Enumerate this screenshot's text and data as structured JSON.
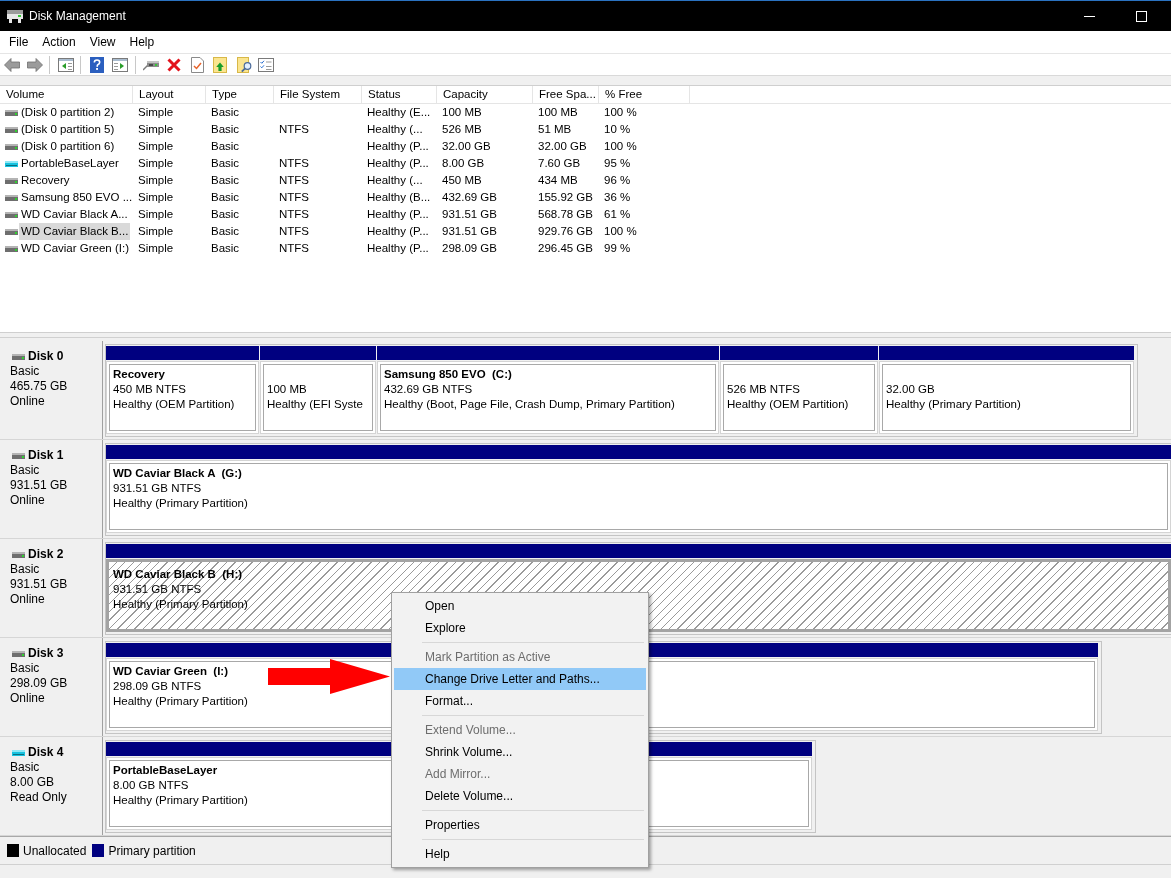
{
  "window": {
    "title": "Disk Management"
  },
  "menu_bar": [
    "File",
    "Action",
    "View",
    "Help"
  ],
  "volume_table": {
    "columns": [
      "Volume",
      "Layout",
      "Type",
      "File System",
      "Status",
      "Capacity",
      "Free Spa...",
      "% Free"
    ],
    "rows": [
      {
        "kind": "fixed",
        "selected": false,
        "cells": [
          "(Disk 0 partition 2)",
          "Simple",
          "Basic",
          null,
          "Healthy (E...",
          "100 MB",
          "100 MB",
          "100 %"
        ]
      },
      {
        "kind": "fixed",
        "selected": false,
        "cells": [
          "(Disk 0 partition 5)",
          "Simple",
          "Basic",
          "NTFS",
          "Healthy (...",
          "526 MB",
          "51 MB",
          "10 %"
        ]
      },
      {
        "kind": "fixed",
        "selected": false,
        "cells": [
          "(Disk 0 partition 6)",
          "Simple",
          "Basic",
          null,
          "Healthy (P...",
          "32.00 GB",
          "32.00 GB",
          "100 %"
        ]
      },
      {
        "kind": "removable",
        "selected": false,
        "cells": [
          "PortableBaseLayer",
          "Simple",
          "Basic",
          "NTFS",
          "Healthy (P...",
          "8.00 GB",
          "7.60 GB",
          "95 %"
        ]
      },
      {
        "kind": "fixed",
        "selected": false,
        "cells": [
          "Recovery",
          "Simple",
          "Basic",
          "NTFS",
          "Healthy (...",
          "450 MB",
          "434 MB",
          "96 %"
        ]
      },
      {
        "kind": "fixed",
        "selected": false,
        "cells": [
          "Samsung 850 EVO ...",
          "Simple",
          "Basic",
          "NTFS",
          "Healthy (B...",
          "432.69 GB",
          "155.92 GB",
          "36 %"
        ]
      },
      {
        "kind": "fixed",
        "selected": false,
        "cells": [
          "WD Caviar Black A...",
          "Simple",
          "Basic",
          "NTFS",
          "Healthy (P...",
          "931.51 GB",
          "568.78 GB",
          "61 %"
        ]
      },
      {
        "kind": "fixed",
        "selected": true,
        "cells": [
          "WD Caviar Black B...",
          "Simple",
          "Basic",
          "NTFS",
          "Healthy (P...",
          "931.51 GB",
          "929.76 GB",
          "100 %"
        ]
      },
      {
        "kind": "fixed",
        "selected": false,
        "cells": [
          "WD Caviar Green (I:)",
          "Simple",
          "Basic",
          "NTFS",
          "Healthy (P...",
          "298.09 GB",
          "296.45 GB",
          "99 %"
        ]
      }
    ]
  },
  "disks": [
    {
      "kind": "fixed",
      "name": "Disk 0",
      "type": "Basic",
      "size": "465.75 GB",
      "status": "Online",
      "partitions": [
        {
          "name": "Recovery",
          "size": "450 MB NTFS",
          "status": "Healthy (OEM Partition)",
          "selected": false
        },
        {
          "size": "100 MB",
          "status": "Healthy (EFI Syste",
          "selected": false
        },
        {
          "name": "Samsung 850 EVO  (C:)",
          "size": "432.69 GB NTFS",
          "status": "Healthy (Boot, Page File, Crash Dump, Primary Partition)",
          "selected": false
        },
        {
          "size": "526 MB NTFS",
          "status": "Healthy (OEM Partition)",
          "selected": false
        },
        {
          "size": "32.00 GB",
          "status": "Healthy (Primary Partition)",
          "selected": false
        }
      ]
    },
    {
      "kind": "fixed",
      "name": "Disk 1",
      "type": "Basic",
      "size": "931.51 GB",
      "status": "Online",
      "partitions": [
        {
          "name": "WD Caviar Black A  (G:)",
          "size": "931.51 GB NTFS",
          "status": "Healthy (Primary Partition)",
          "selected": false
        }
      ]
    },
    {
      "kind": "fixed",
      "name": "Disk 2",
      "type": "Basic",
      "size": "931.51 GB",
      "status": "Online",
      "partitions": [
        {
          "name": "WD Caviar Black B  (H:)",
          "size": "931.51 GB NTFS",
          "status": "Healthy (Primary Partition)",
          "selected": true
        }
      ]
    },
    {
      "kind": "fixed",
      "name": "Disk 3",
      "type": "Basic",
      "size": "298.09 GB",
      "status": "Online",
      "partitions": [
        {
          "name": "WD Caviar Green  (I:)",
          "size": "298.09 GB NTFS",
          "status": "Healthy (Primary Partition)",
          "selected": false
        }
      ]
    },
    {
      "kind": "removable",
      "name": "Disk 4",
      "type": "Basic",
      "size": "8.00 GB",
      "status": "Read Only",
      "partitions": [
        {
          "name": "PortableBaseLayer",
          "size": "8.00 GB NTFS",
          "status": "Healthy (Primary Partition)",
          "selected": false
        }
      ]
    }
  ],
  "legend": [
    {
      "label": "Unallocated",
      "color": "#000000"
    },
    {
      "label": "Primary partition",
      "color": "#000080"
    }
  ],
  "context_menu": {
    "groups": [
      [
        {
          "label": "Open",
          "disabled": false,
          "selected": false
        },
        {
          "label": "Explore",
          "disabled": false,
          "selected": false
        }
      ],
      [
        {
          "label": "Mark Partition as Active",
          "disabled": true,
          "selected": false
        },
        {
          "label": "Change Drive Letter and Paths...",
          "disabled": false,
          "selected": true
        },
        {
          "label": "Format...",
          "disabled": false,
          "selected": false
        }
      ],
      [
        {
          "label": "Extend Volume...",
          "disabled": true,
          "selected": false
        },
        {
          "label": "Shrink Volume...",
          "disabled": false,
          "selected": false
        },
        {
          "label": "Add Mirror...",
          "disabled": true,
          "selected": false
        },
        {
          "label": "Delete Volume...",
          "disabled": false,
          "selected": false
        }
      ],
      [
        {
          "label": "Properties",
          "disabled": false,
          "selected": false
        }
      ],
      [
        {
          "label": "Help",
          "disabled": false,
          "selected": false
        }
      ]
    ]
  }
}
